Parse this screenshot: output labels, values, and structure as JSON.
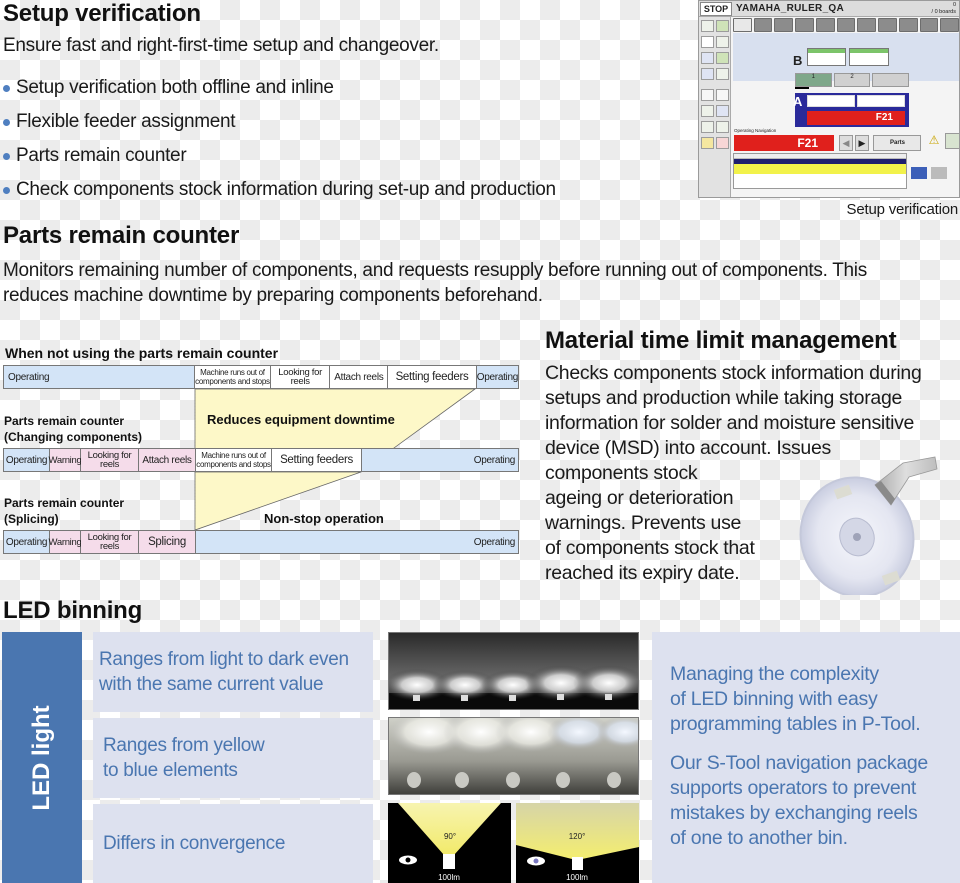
{
  "setup_verification": {
    "heading": "Setup verification",
    "lead": "Ensure fast and right-first-time setup and changeover.",
    "bullets": [
      "Setup verification both offline and inline",
      "Flexible feeder assignment",
      "Parts remain counter",
      "Check components stock information during set-up and production"
    ],
    "screenshot": {
      "stop_label": "STOP",
      "program_name": "YAMAHA_RULER_QA",
      "board_count": "0",
      "board_total": "/ 0 boards",
      "head_b_label": "B",
      "head_a_label": "A",
      "slot_labels": [
        "1",
        "2"
      ],
      "error_code": "F21",
      "nav_error_code": "F21",
      "parts_label": "Parts",
      "section_title": "Operating Navigation"
    },
    "caption": "Setup verification"
  },
  "parts_remain_counter": {
    "heading": "Parts remain counter",
    "body_lines": [
      "Monitors remaining number of components, and requests resupply before running out of components. This",
      "reduces machine downtime by preparing components beforehand."
    ]
  },
  "timeline_diagram": {
    "title": "When not using the parts remain counter",
    "rows": [
      {
        "label": [],
        "cells": [
          {
            "text": "Operating",
            "type": "op"
          },
          {
            "text": "Machine runs out of components and stops",
            "type": "wh"
          },
          {
            "text": "Looking for reels",
            "type": "wh"
          },
          {
            "text": "Attach reels",
            "type": "wh"
          },
          {
            "text": "Setting feeders",
            "type": "wh"
          },
          {
            "text": "Operating",
            "type": "op"
          }
        ]
      },
      {
        "label": [
          "Parts remain counter",
          "(Changing components)"
        ],
        "cells": [
          {
            "text": "Operating",
            "type": "op"
          },
          {
            "text": "Warning",
            "type": "warn"
          },
          {
            "text": "Looking for reels",
            "type": "warn"
          },
          {
            "text": "Attach reels",
            "type": "warn"
          },
          {
            "text": "Machine runs out of components and stops",
            "type": "wh"
          },
          {
            "text": "Setting feeders",
            "type": "wh"
          },
          {
            "text": "Operating",
            "type": "op"
          }
        ]
      },
      {
        "label": [
          "Parts remain counter",
          "(Splicing)"
        ],
        "cells": [
          {
            "text": "Operating",
            "type": "op"
          },
          {
            "text": "Warning",
            "type": "warn"
          },
          {
            "text": "Looking for reels",
            "type": "warn"
          },
          {
            "text": "Splicing",
            "type": "warn"
          },
          {
            "text": "Operating",
            "type": "op"
          }
        ]
      }
    ],
    "notes": {
      "reduces": "Reduces equipment downtime",
      "nonstop": "Non-stop operation"
    },
    "colors": {
      "operating": "#d3e4f7",
      "warning": "#f5dcea",
      "saved_area": "#fdf8c8"
    }
  },
  "material_time_limit": {
    "heading": "Material time limit management",
    "body_lines": [
      "Checks components stock information during",
      "setups and production while taking storage",
      "information for solder and moisture sensitive",
      "device (MSD) into account. Issues",
      "components stock",
      "ageing or deterioration",
      "warnings. Prevents use",
      "of components stock that",
      "reached its expiry date."
    ]
  },
  "led_binning": {
    "heading": "LED binning",
    "side_label": "LED light",
    "items": [
      [
        "Ranges from light to dark even",
        "with the same current value"
      ],
      [
        "Ranges from yellow",
        "to blue elements"
      ],
      [
        "Differs in convergence"
      ]
    ],
    "beam_panels": [
      {
        "angle": "90°",
        "flux": "100lm"
      },
      {
        "angle": "120°",
        "flux": "100lm"
      }
    ],
    "right_paragraphs": [
      [
        "Managing the complexity",
        "of LED binning with easy",
        "programming tables in P-Tool."
      ],
      [
        "Our S-Tool navigation package",
        "supports operators to prevent",
        "mistakes by exchanging reels",
        "of one to another bin."
      ]
    ],
    "colors": {
      "accent": "#4a76b0",
      "panel": "#dde1ef"
    }
  }
}
